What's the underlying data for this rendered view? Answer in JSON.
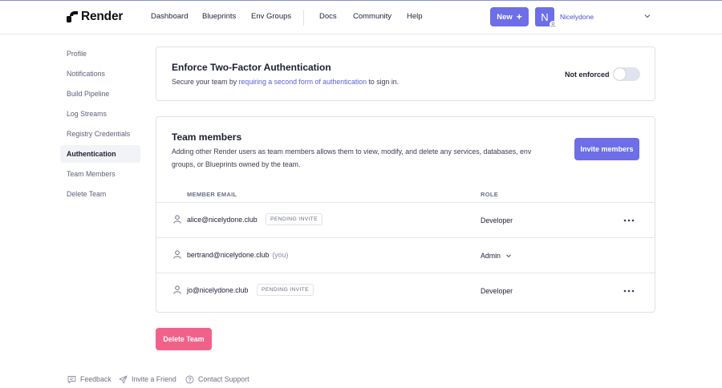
{
  "header": {
    "logo_text": "Render",
    "nav": [
      "Dashboard",
      "Blueprints",
      "Env Groups",
      "Docs",
      "Community",
      "Help"
    ],
    "new_label": "New",
    "avatar_initial": "N",
    "account_name": "Nicelydone"
  },
  "sidebar": {
    "items": [
      {
        "label": "Profile"
      },
      {
        "label": "Notifications"
      },
      {
        "label": "Build Pipeline"
      },
      {
        "label": "Log Streams"
      },
      {
        "label": "Registry Credentials"
      },
      {
        "label": "Authentication",
        "active": true
      },
      {
        "label": "Team Members"
      },
      {
        "label": "Delete Team"
      }
    ]
  },
  "two_factor": {
    "title": "Enforce Two-Factor Authentication",
    "desc_before": "Secure your team by ",
    "desc_link": "requiring a second form of authentication",
    "desc_after": " to sign in.",
    "status_label": "Not enforced",
    "enforced": false
  },
  "team": {
    "title": "Team members",
    "description": "Adding other Render users as team members allows them to view, modify, and delete any services, databases, env groups, or Blueprints owned by the team.",
    "invite_label": "Invite members",
    "columns": {
      "email": "MEMBER EMAIL",
      "role": "ROLE"
    },
    "members": [
      {
        "email": "alice@nicelydone.club",
        "badge": "PENDING INVITE",
        "role": "Developer"
      },
      {
        "email": "bertrand@nicelydone.club",
        "you": "(you)",
        "role": "Admin"
      },
      {
        "email": "jo@nicelydone.club",
        "badge": "PENDING INVITE",
        "role": "Developer"
      }
    ]
  },
  "delete_team_label": "Delete Team",
  "footer": {
    "feedback": "Feedback",
    "invite_friend": "Invite a Friend",
    "contact_support": "Contact Support"
  },
  "colors": {
    "accent": "#6d6ee8",
    "link": "#5b5fd6",
    "danger": "#f1628a"
  }
}
